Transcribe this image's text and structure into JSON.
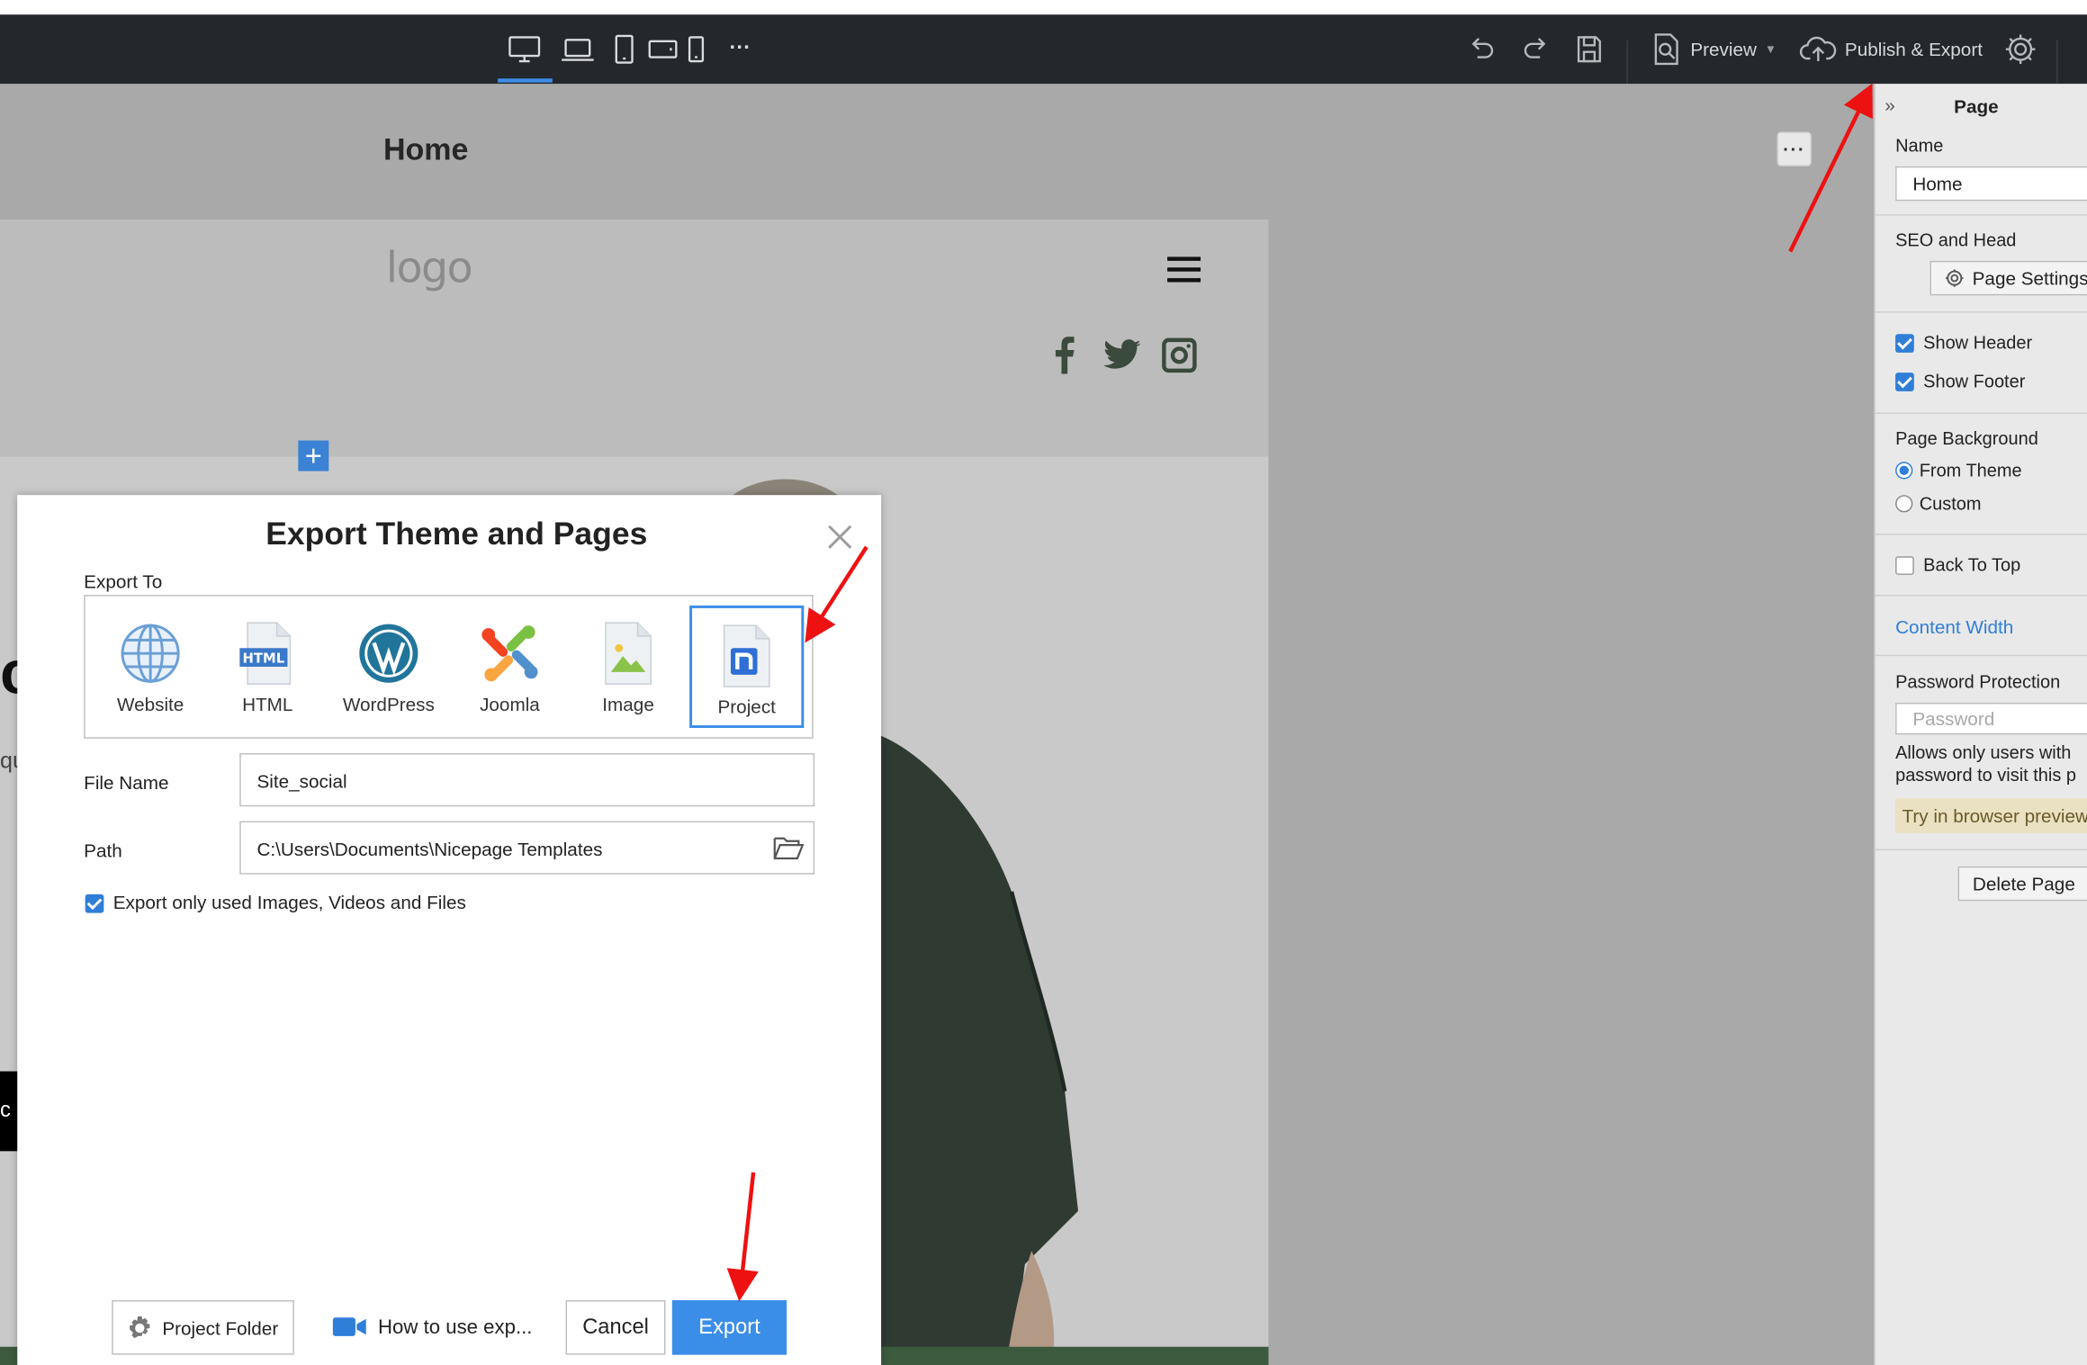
{
  "toolbar": {
    "devices": [
      "desktop-icon",
      "laptop-icon",
      "tablet-icon",
      "tablet-landscape-icon",
      "phone-icon",
      "more-icon"
    ],
    "more_devices": "···",
    "preview_label": "Preview",
    "publish_label": "Publish & Export",
    "accent_color": "#3b8ee8"
  },
  "canvas": {
    "page_title": "Home",
    "more_label": "···",
    "logo_text": "logo",
    "plus_label": "+",
    "edge_letter": "c",
    "edge_text": "qu",
    "black_tab_letter": "c"
  },
  "panel": {
    "title": "Page",
    "name_label": "Name",
    "name_value": "Home",
    "seo_label": "SEO and Head",
    "page_settings_label": "Page Settings",
    "show_header_label": "Show Header",
    "show_footer_label": "Show Footer",
    "page_background_label": "Page Background",
    "from_theme_label": "From Theme",
    "custom_label": "Custom",
    "back_to_top_label": "Back To Top",
    "content_width_label": "Content Width",
    "password_protection_label": "Password Protection",
    "password_placeholder": "Password",
    "hint_line1": "Allows only users with",
    "hint_line2": "password to visit this p",
    "try_label": "Try in browser preview",
    "delete_label": "Delete Page"
  },
  "modal": {
    "title": "Export Theme and Pages",
    "export_to_label": "Export To",
    "targets": [
      {
        "label": "Website",
        "icon": "globe-icon"
      },
      {
        "label": "HTML",
        "icon": "html-file-icon"
      },
      {
        "label": "WordPress",
        "icon": "wordpress-icon"
      },
      {
        "label": "Joomla",
        "icon": "joomla-icon"
      },
      {
        "label": "Image",
        "icon": "image-file-icon"
      },
      {
        "label": "Project",
        "icon": "nicepage-project-icon"
      }
    ],
    "selected_target": "Project",
    "file_name_label": "File Name",
    "file_name_value": "Site_social",
    "path_label": "Path",
    "path_value": "C:\\Users\\Documents\\Nicepage Templates",
    "export_used_only_label": "Export only used Images, Videos and Files",
    "project_folder_label": "Project Folder",
    "how_to_label": "How to use exp...",
    "cancel_label": "Cancel",
    "export_label": "Export"
  }
}
